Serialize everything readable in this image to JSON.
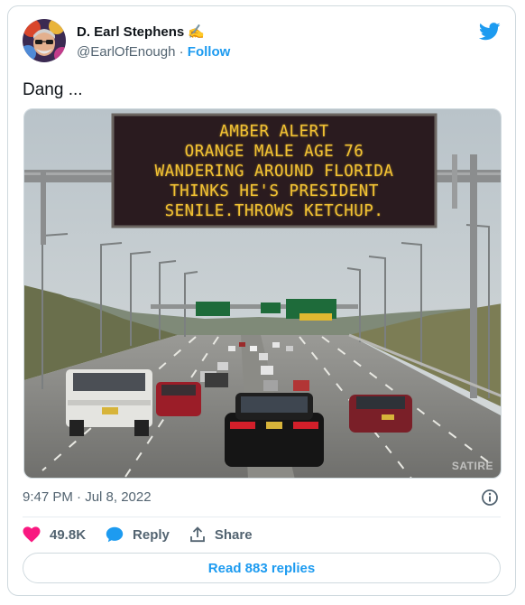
{
  "author": {
    "display_name": "D. Earl Stephens",
    "name_emoji": "✍️",
    "handle": "@EarlOfEnough",
    "separator": "·",
    "follow_label": "Follow"
  },
  "tweet": {
    "text": "Dang ...",
    "timestamp": "9:47 PM · Jul 8, 2022"
  },
  "media": {
    "sign_lines": [
      "AMBER ALERT",
      "ORANGE MALE AGE 76",
      "WANDERING AROUND FLORIDA",
      "THINKS HE'S PRESIDENT",
      "SENILE.THROWS KETCHUP."
    ],
    "watermark": "SATIRE"
  },
  "actions": {
    "likes": "49.8K",
    "reply_label": "Reply",
    "share_label": "Share"
  },
  "read_replies_label": "Read 883 replies",
  "icons": {
    "brand": "twitter-bird-icon",
    "info": "info-icon",
    "like": "heart-icon",
    "reply": "speech-bubble-icon",
    "share": "share-upload-icon"
  },
  "colors": {
    "accent": "#1d9bf0",
    "like": "#f91880",
    "sign_text": "#f2c233",
    "muted": "#536471"
  }
}
